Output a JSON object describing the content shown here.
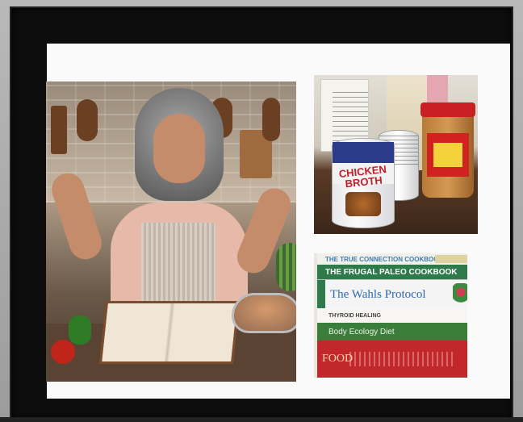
{
  "scene": {
    "description_hidden": "",
    "frame_color": "#0d0d0d",
    "mat_color": "#fafafa"
  },
  "photos": {
    "main": {
      "icon": "woman-cooking-photo"
    },
    "cans": {
      "broth_can_text": "CHICKEN BROTH",
      "icon": "cans-and-jars-photo"
    },
    "books": {
      "icon": "stacked-books-photo",
      "spines": [
        "THE TRUE CONNECTION COOKBOOK",
        "THE FRUGAL PALEO COOKBOOK",
        "The Wahls Protocol",
        "THYROID HEALING",
        "Body Ecology Diet",
        "FOOD"
      ]
    }
  }
}
